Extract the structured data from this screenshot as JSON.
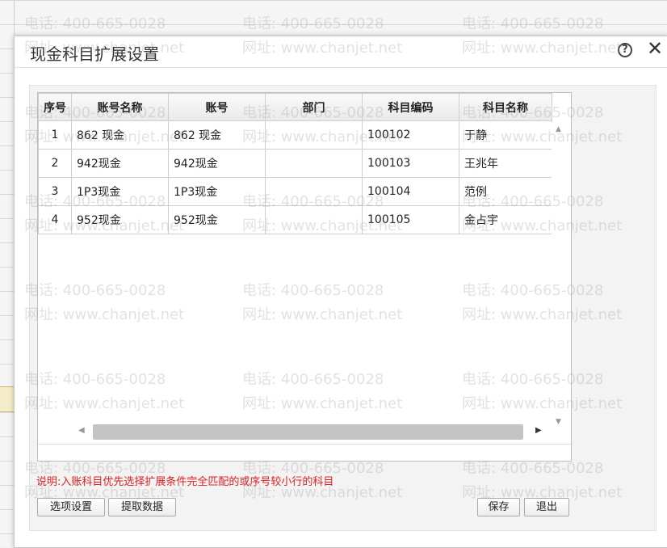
{
  "dialog": {
    "title": "现金科目扩展设置",
    "help_label": "?",
    "close_label": "✕"
  },
  "table": {
    "columns": [
      "序号",
      "账号名称",
      "账号",
      "部门",
      "科目编码",
      "科目名称"
    ],
    "rows": [
      [
        "1",
        "862 现金",
        "862 现金",
        "",
        "100102",
        "于静"
      ],
      [
        "2",
        "942现金",
        "942现金",
        "",
        "100103",
        "王兆年"
      ],
      [
        "3",
        "1P3现金",
        "1P3现金",
        "",
        "100104",
        "范例"
      ],
      [
        "4",
        "952现金",
        "952现金",
        "",
        "100105",
        "金占宇"
      ]
    ]
  },
  "scroll": {
    "up": "▲",
    "down": "▼",
    "left": "◀",
    "right": "▶"
  },
  "note": "说明:入账科目优先选择扩展条件完全匹配的或序号较小行的科目",
  "buttons": {
    "options": "选项设置",
    "fetch": "提取数据",
    "save": "保存",
    "exit": "退出"
  },
  "watermark": {
    "phone": "电话: 400-665-0028",
    "site": "网址: www.chanjet.net"
  },
  "colors": {
    "note": "#e02020",
    "header_bg": "#e9e9e9"
  }
}
